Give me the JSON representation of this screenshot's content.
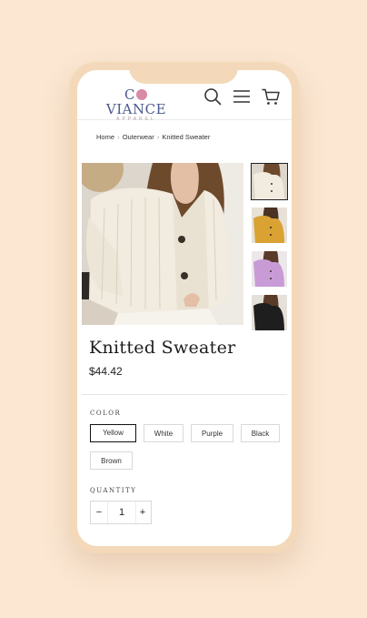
{
  "brand": {
    "name_left": "C",
    "name_right": "VIANCE",
    "sub": "APPAREL"
  },
  "header_icons": [
    "search-icon",
    "hamburger-menu-icon",
    "cart-icon"
  ],
  "breadcrumb": {
    "items": [
      "Home",
      "Outerwear",
      "Knitted Sweater"
    ],
    "separator": "›"
  },
  "product": {
    "title": "Knitted Sweater",
    "price": "$44.42"
  },
  "images": {
    "main": "cream knitted cardigan",
    "thumbnails": [
      "cream",
      "mustard",
      "lilac",
      "black"
    ]
  },
  "color_option": {
    "label": "COLOR",
    "selected": "Yellow",
    "choices": [
      "Yellow",
      "White",
      "Purple",
      "Black",
      "Brown"
    ]
  },
  "quantity": {
    "label": "QUANTITY",
    "minus": "−",
    "value": "1",
    "plus": "+"
  },
  "colors": {
    "background": "#fbe7d2",
    "phone_frame": "#f3d9b9",
    "logo_blue": "#4a5a8e",
    "logo_pink": "#d98aa7"
  }
}
